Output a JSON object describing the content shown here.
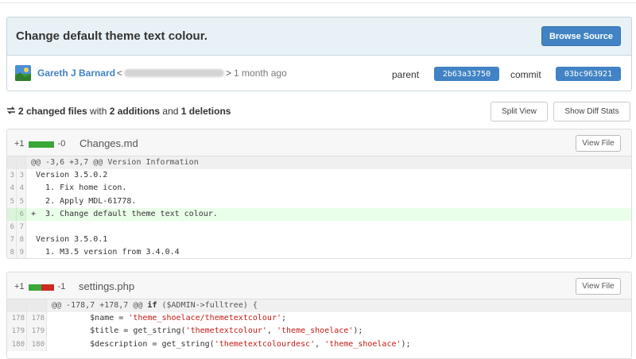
{
  "commit": {
    "title": "Change default theme text colour.",
    "browse_label": "Browse Source",
    "author": "Gareth J Barnard",
    "email_prefix": "<",
    "email_suffix": ">",
    "time_ago": "1 month ago",
    "parent_label": "parent",
    "parent_sha": "2b63a33750",
    "commit_label": "commit",
    "commit_sha": "03bc963921"
  },
  "summary": {
    "icon": "swap-icon",
    "files_count": "2 changed files",
    "with": " with ",
    "additions": "2 additions",
    "and": " and ",
    "deletions": "1 deletions",
    "split_label": "Split View",
    "stats_label": "Show Diff Stats"
  },
  "files": [
    {
      "plus": "+1",
      "minus": "-0",
      "added_fraction": 1.0,
      "name": "Changes.md",
      "view_label": "View File",
      "lines": [
        {
          "type": "hunk",
          "a": "",
          "b": "",
          "text": "@@ -3,6 +3,7 @@ Version Information"
        },
        {
          "type": "ctx",
          "a": "3",
          "b": "3",
          "text": " Version 3.5.0.2"
        },
        {
          "type": "ctx",
          "a": "4",
          "b": "4",
          "text": "   1. Fix home icon."
        },
        {
          "type": "ctx",
          "a": "5",
          "b": "5",
          "text": "   2. Apply MDL-61778."
        },
        {
          "type": "add",
          "a": "",
          "b": "6",
          "text": "+  3. Change default theme text colour."
        },
        {
          "type": "ctx",
          "a": "6",
          "b": "7",
          "text": ""
        },
        {
          "type": "ctx",
          "a": "7",
          "b": "8",
          "text": " Version 3.5.0.1"
        },
        {
          "type": "ctx",
          "a": "8",
          "b": "9",
          "text": "   1. M3.5 version from 3.4.0.4"
        }
      ]
    },
    {
      "plus": "+1",
      "minus": "-1",
      "added_fraction": 0.5,
      "name": "settings.php",
      "view_label": "View File",
      "lines": [
        {
          "type": "hunk",
          "a": "",
          "b": "",
          "text_pre": "@@ -178,7 +178,7 @@ ",
          "kw": "if",
          "text_post": " ($ADMIN->fulltree) {"
        },
        {
          "type": "ctx",
          "a": "178",
          "b": "178",
          "pre": "        $name = ",
          "str": "'theme_shoelace/themetextcolour'",
          "post": ";"
        },
        {
          "type": "ctx",
          "a": "179",
          "b": "179",
          "pre": "        $title = get_string(",
          "str": "'themetextcolour'",
          "mid": ", ",
          "str2": "'theme_shoelace'",
          "post": ");"
        },
        {
          "type": "ctx",
          "a": "180",
          "b": "180",
          "pre": "        $description = get_string(",
          "str": "'themetextcolourdesc'",
          "mid": ", ",
          "str2": "'theme_shoelace'",
          "post": ");"
        }
      ]
    }
  ],
  "colors": {
    "accent": "#4183c4",
    "add_bar": "#3aa838",
    "del_bar": "#cc2a1f",
    "header_bg": "#e8f1f6"
  }
}
